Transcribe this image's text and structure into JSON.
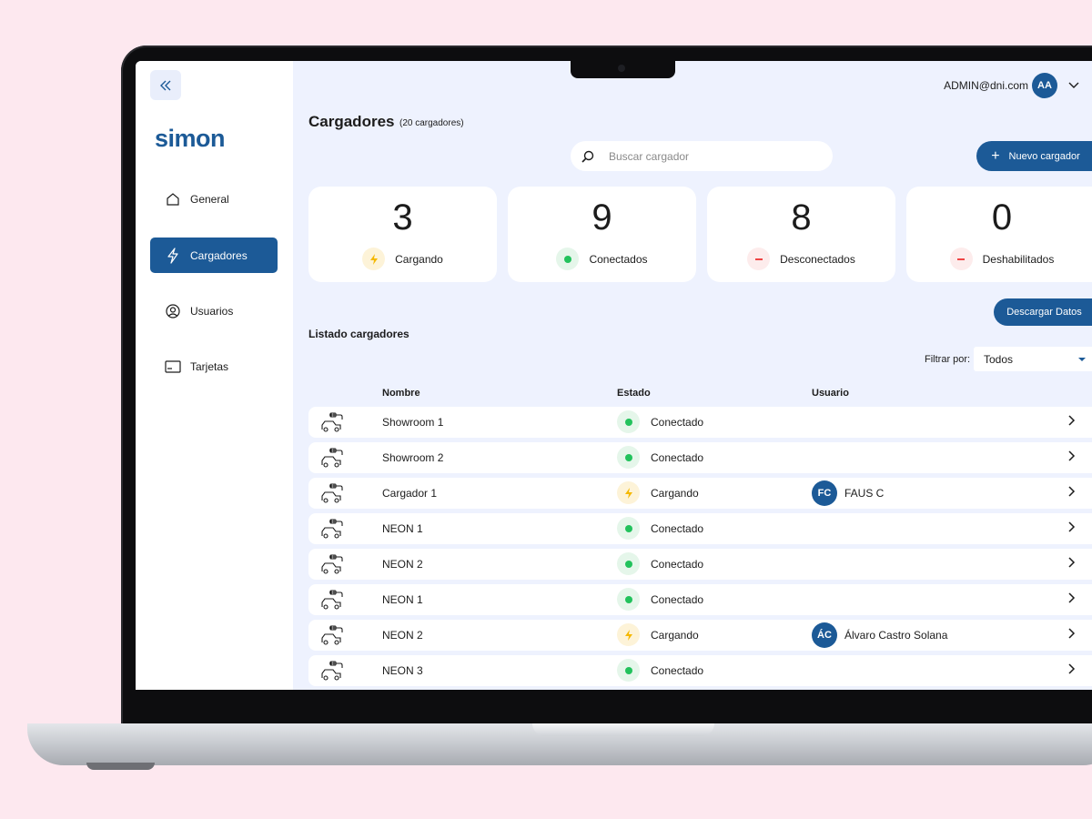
{
  "sidebar": {
    "logo": "simon",
    "items": [
      {
        "label": "General",
        "icon": "home-icon"
      },
      {
        "label": "Cargadores",
        "icon": "lightning-icon"
      },
      {
        "label": "Usuarios",
        "icon": "user-circle-icon"
      },
      {
        "label": "Tarjetas",
        "icon": "card-icon"
      }
    ],
    "active": "Cargadores"
  },
  "header": {
    "user_email": "ADMIN@dni.com",
    "user_initials": "AA"
  },
  "page": {
    "title": "Cargadores",
    "count": "(20 cargadores)"
  },
  "search": {
    "placeholder": "Buscar cargador",
    "value": ""
  },
  "actions": {
    "new_label": "Nuevo cargador",
    "download_label": "Descargar Datos"
  },
  "stats": [
    {
      "value": "3",
      "label": "Cargando",
      "status": "charging"
    },
    {
      "value": "9",
      "label": "Conectados",
      "status": "connected"
    },
    {
      "value": "8",
      "label": "Desconectados",
      "status": "disconnected"
    },
    {
      "value": "0",
      "label": "Deshabilitados",
      "status": "disconnected"
    }
  ],
  "list": {
    "title": "Listado cargadores",
    "filter_label": "Filtrar por:",
    "filter_value": "Todos",
    "columns": [
      "Nombre",
      "Estado",
      "Usuario"
    ],
    "rows": [
      {
        "name": "Showroom 1",
        "state": "Conectado",
        "status": "connected",
        "user": "",
        "initials": ""
      },
      {
        "name": "Showroom 2",
        "state": "Conectado",
        "status": "connected",
        "user": "",
        "initials": ""
      },
      {
        "name": "Cargador 1",
        "state": "Cargando",
        "status": "charging",
        "user": "FAUS C",
        "initials": "FC"
      },
      {
        "name": "NEON 1",
        "state": "Conectado",
        "status": "connected",
        "user": "",
        "initials": ""
      },
      {
        "name": "NEON 2",
        "state": "Conectado",
        "status": "connected",
        "user": "",
        "initials": ""
      },
      {
        "name": "NEON 1",
        "state": "Conectado",
        "status": "connected",
        "user": "",
        "initials": ""
      },
      {
        "name": "NEON 2",
        "state": "Cargando",
        "status": "charging",
        "user": "Álvaro Castro Solana",
        "initials": "ÁC"
      },
      {
        "name": "NEON 3",
        "state": "Conectado",
        "status": "connected",
        "user": "",
        "initials": ""
      }
    ]
  },
  "colors": {
    "brand": "#1c5a97",
    "background": "#eef2fe",
    "connected": "#22c25c",
    "charging": "#f5b800",
    "disconnected": "#ef4444"
  }
}
